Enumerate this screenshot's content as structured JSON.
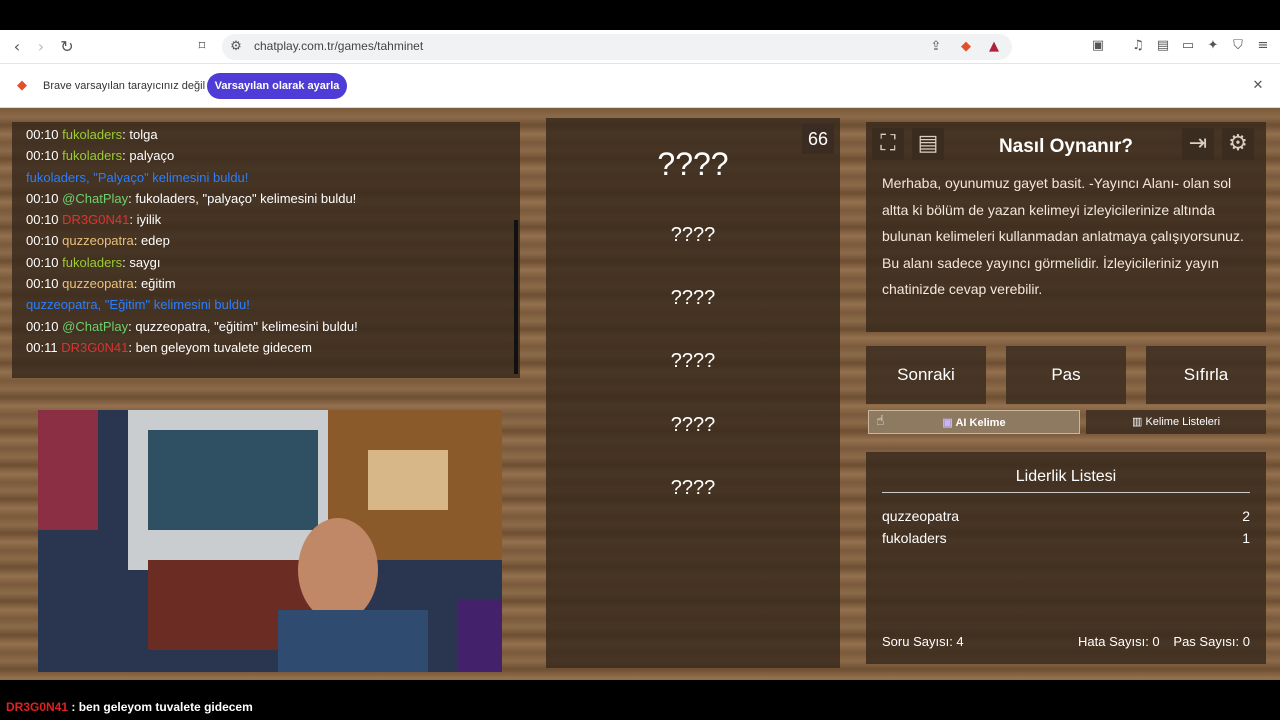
{
  "browser": {
    "url": "chatplay.com.tr/games/tahminet",
    "back_icon": "chevron-left-icon",
    "forward_icon": "chevron-right-icon",
    "reload_icon": "reload-icon"
  },
  "infobar": {
    "message": "Brave varsayılan tarayıcınız değil",
    "button_label": "Varsayılan olarak ayarla",
    "close_icon": "close-icon"
  },
  "chat": {
    "lines": [
      {
        "time": "00:10 ",
        "user": "fukoladers",
        "text": ": tolga"
      },
      {
        "time": "00:10 ",
        "user": "fukoladers",
        "text": ": palyaço"
      },
      {
        "time": "",
        "user": "fukoladers, ",
        "text": "\"Palyaço\" kelimesini buldu!"
      },
      {
        "time": "00:10 ",
        "user": "@ChatPlay",
        "text": ": fukoladers, \"palyaço\" kelimesini buldu!"
      },
      {
        "time": "00:10 ",
        "user": "DR3G0N41",
        "text": ": iyilik"
      },
      {
        "time": "00:10 ",
        "user": "quzzeopatra",
        "text": ": edep"
      },
      {
        "time": "00:10 ",
        "user": "fukoladers",
        "text": ": saygı"
      },
      {
        "time": "00:10 ",
        "user": "quzzeopatra",
        "text": ": eğitim"
      },
      {
        "time": "",
        "user": "quzzeopatra, ",
        "text": "\"Eğitim\" kelimesini buldu!"
      },
      {
        "time": "00:10 ",
        "user": "@ChatPlay",
        "text": ": quzzeopatra, \"eğitim\" kelimesini buldu!"
      },
      {
        "time": "00:11 ",
        "user": "DR3G0N41",
        "text": ": ben geleyom tuvalete gidecem"
      }
    ]
  },
  "words": {
    "counter": "66",
    "items": [
      "????",
      "????",
      "????",
      "????",
      "????",
      "????"
    ]
  },
  "howto": {
    "title": "Nasıl Oynanır?",
    "text": "Merhaba, oyunumuz gayet basit. -Yayıncı Alanı- olan sol altta ki bölüm de yazan kelimeyi izleyicilerinize altında bulunan kelimeleri kullanmadan anlatmaya çalışıyorsunuz. Bu alanı sadece yayıncı görmelidir. İzleyicileriniz yayın chatinizde cevap verebilir."
  },
  "controls": {
    "next": "Sonraki",
    "pass": "Pas",
    "reset": "Sıfırla",
    "ai_word": "AI Kelime",
    "word_lists": "Kelime Listeleri"
  },
  "leaderboard": {
    "title": "Liderlik Listesi",
    "rows": [
      {
        "name": "quzzeopatra",
        "score": "2"
      },
      {
        "name": "fukoladers",
        "score": "1"
      }
    ],
    "question_count": "Soru Sayısı: 4",
    "error_count": "Hata Sayısı: 0",
    "pass_count": "Pas Sayısı: 0"
  },
  "overlay": {
    "user": "DR3G0N41",
    "text": " : ben geleyom tuvalete gidecem"
  }
}
